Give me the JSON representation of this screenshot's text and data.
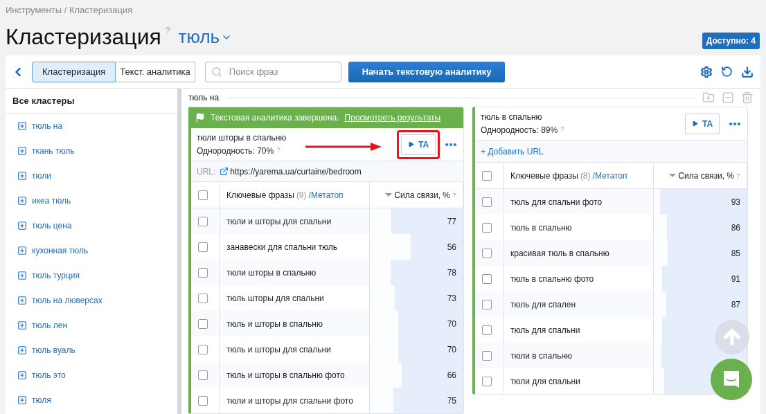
{
  "breadcrumb": "Инструменты / Кластеризация",
  "title": "Кластеризация",
  "title_hint": "?",
  "project": "тюль",
  "available_badge": "Доступно: 4",
  "toolbar": {
    "tabs": [
      {
        "label": "Кластеризация",
        "selected": true
      },
      {
        "label": "Текст. аналитика",
        "selected": false
      }
    ],
    "search": {
      "placeholder": "Поиск фраз"
    },
    "start_button": "Начать текстовую аналитику"
  },
  "sidebar": {
    "title": "Все кластеры",
    "items": [
      {
        "label": "тюль на"
      },
      {
        "label": "ткань тюль"
      },
      {
        "label": "тюли"
      },
      {
        "label": "икеа тюль"
      },
      {
        "label": "тюль цена"
      },
      {
        "label": "кухонная тюль"
      },
      {
        "label": "тюль турция"
      },
      {
        "label": "тюль на люверсах"
      },
      {
        "label": "тюль лен"
      },
      {
        "label": "тюль вуаль"
      },
      {
        "label": "тюль это"
      },
      {
        "label": "тюля"
      }
    ]
  },
  "group": {
    "title": "тюль на"
  },
  "clusters": [
    {
      "banner": {
        "text": "Текстовая аналитика завершена.",
        "link": "Просмотреть результаты"
      },
      "name": "тюли шторы в спальню",
      "homogeneity": "Однородность: 70%",
      "hint": "?",
      "ta_button": "ТА",
      "highlighted": true,
      "url": {
        "label": "URL:",
        "value": "https://yarema.ua/curtaine/bedroom"
      },
      "columns": {
        "all_checked": false,
        "phrases": "Ключевые фразы",
        "count": "(9)",
        "metatop": "/Метатоп",
        "strength": "Сила связи, %",
        "hint": "?"
      },
      "rows": [
        {
          "phrase": "тюли и шторы для спальни",
          "value": "77",
          "level": 0.77,
          "checked": false
        },
        {
          "phrase": "занавески для спальни тюль",
          "value": "56",
          "level": 0.56,
          "checked": false
        },
        {
          "phrase": "тюли шторы в спальню",
          "value": "78",
          "level": 0.78,
          "checked": false
        },
        {
          "phrase": "тюль шторы для спальни",
          "value": "73",
          "level": 0.73,
          "checked": false
        },
        {
          "phrase": "тюль и шторы в спальню",
          "value": "70",
          "level": 0.7,
          "checked": false
        },
        {
          "phrase": "тюль и шторы для спальни",
          "value": "70",
          "level": 0.7,
          "checked": false
        },
        {
          "phrase": "тюль и шторы в спальню фото",
          "value": "66",
          "level": 0.66,
          "checked": false
        },
        {
          "phrase": "тюли и шторы для спальни фото",
          "value": "75",
          "level": 0.75,
          "checked": false
        }
      ]
    },
    {
      "name": "тюль в спальню",
      "homogeneity": "Однородность: 89%",
      "hint": "?",
      "ta_button": "ТА",
      "highlighted": false,
      "add_url": "+ Добавить URL",
      "columns": {
        "all_checked": false,
        "phrases": "Ключевые фразы",
        "count": "(8)",
        "metatop": "/Метатоп",
        "strength": "Сила связи, %",
        "hint": "?"
      },
      "rows": [
        {
          "phrase": "тюль для спальни фото",
          "value": "93",
          "level": 0.93,
          "checked": false
        },
        {
          "phrase": "тюль в спальню",
          "value": "86",
          "level": 0.86,
          "checked": false
        },
        {
          "phrase": "красивая тюль в спальню",
          "value": "85",
          "level": 0.85,
          "checked": false
        },
        {
          "phrase": "тюль в спальню фото",
          "value": "91",
          "level": 0.91,
          "checked": false
        },
        {
          "phrase": "тюль для спален",
          "value": "87",
          "level": 0.87,
          "checked": false
        },
        {
          "phrase": "тюль для спальни",
          "level": 0.91,
          "checked": false
        },
        {
          "phrase": "тюли в спальню",
          "level": 0.92,
          "checked": false
        },
        {
          "phrase": "тюли для спальни",
          "level": 0.89,
          "checked": false
        }
      ]
    }
  ]
}
